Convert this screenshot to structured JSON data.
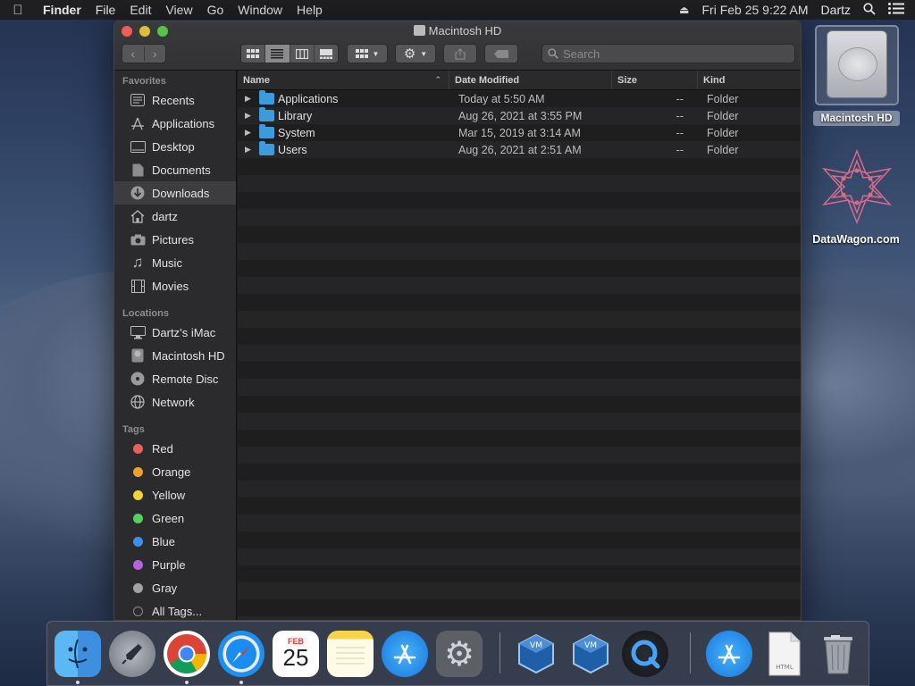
{
  "menubar": {
    "apple": "",
    "app": "Finder",
    "items": [
      "File",
      "Edit",
      "View",
      "Go",
      "Window",
      "Help"
    ],
    "clock": "Fri Feb 25  9:22 AM",
    "user": "Dartz"
  },
  "window": {
    "title": "Macintosh HD",
    "search_placeholder": "Search"
  },
  "sidebar": {
    "favorites_label": "Favorites",
    "favorites": [
      "Recents",
      "Applications",
      "Desktop",
      "Documents",
      "Downloads",
      "dartz",
      "Pictures",
      "Music",
      "Movies"
    ],
    "locations_label": "Locations",
    "locations": [
      "Dartz’s iMac",
      "Macintosh HD",
      "Remote Disc",
      "Network"
    ],
    "tags_label": "Tags",
    "tags": [
      {
        "label": "Red",
        "color": "#ec5f57"
      },
      {
        "label": "Orange",
        "color": "#f0a02a"
      },
      {
        "label": "Yellow",
        "color": "#f4d430"
      },
      {
        "label": "Green",
        "color": "#52d15b"
      },
      {
        "label": "Blue",
        "color": "#3c8ff0"
      },
      {
        "label": "Purple",
        "color": "#b561e0"
      },
      {
        "label": "Gray",
        "color": "#a2a2a6"
      }
    ],
    "all_tags": "All Tags..."
  },
  "columns": {
    "name": "Name",
    "date": "Date Modified",
    "size": "Size",
    "kind": "Kind"
  },
  "files": [
    {
      "name": "Applications",
      "date": "Today at 5:50 AM",
      "size": "--",
      "kind": "Folder"
    },
    {
      "name": "Library",
      "date": "Aug 26, 2021 at 3:55 PM",
      "size": "--",
      "kind": "Folder"
    },
    {
      "name": "System",
      "date": "Mar 15, 2019 at 3:14 AM",
      "size": "--",
      "kind": "Folder"
    },
    {
      "name": "Users",
      "date": "Aug 26, 2021 at 2:51 AM",
      "size": "--",
      "kind": "Folder"
    }
  ],
  "desktop": {
    "hd_label": "Macintosh HD",
    "dw_label": "DataWagon.com"
  },
  "dock": {
    "calendar_month": "FEB",
    "calendar_day": "25"
  }
}
